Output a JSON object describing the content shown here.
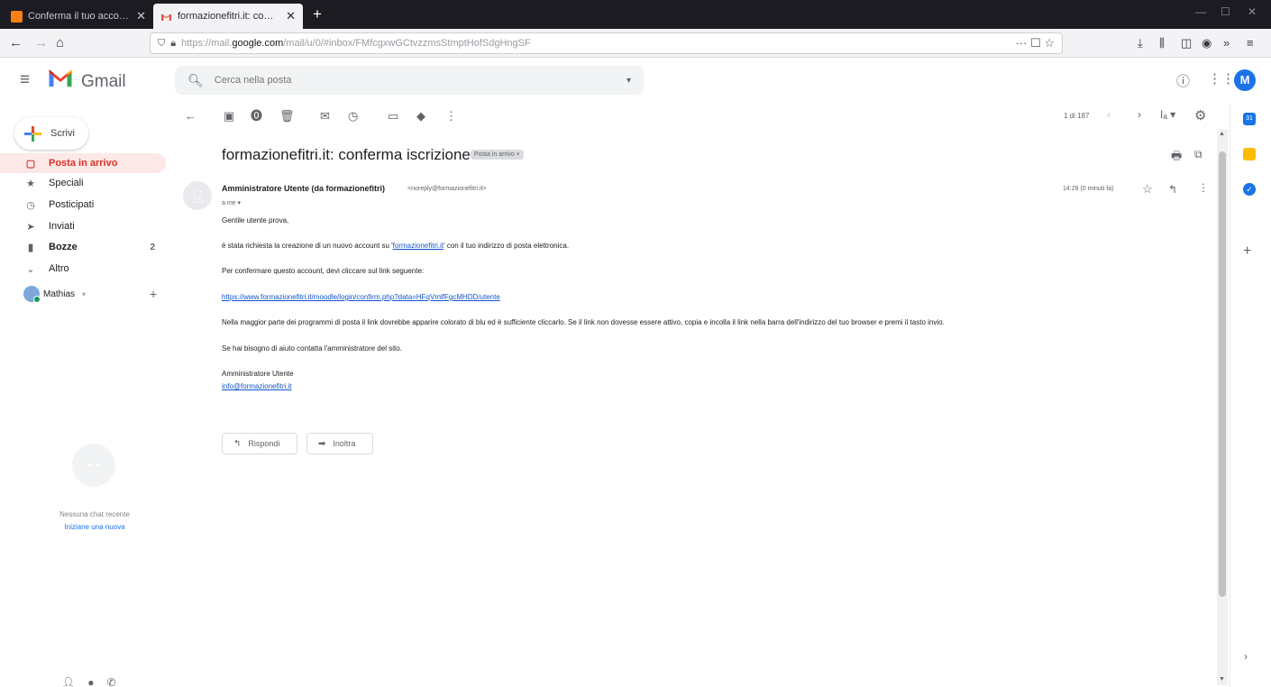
{
  "browser": {
    "tabs": [
      {
        "title": "Conferma il tuo account",
        "active": false
      },
      {
        "title": "formazionefitri.it: conferma iscr",
        "active": true
      }
    ],
    "url_prefix": "https://mail.",
    "url_domain": "google.com",
    "url_path": "/mail/u/0/#inbox/FMfcgxwGCtvzzmsStmptHofSdgHngSF",
    "url_actions": "··· ☐ ☆"
  },
  "gmail": {
    "logo_text": "Gmail",
    "search_placeholder": "Cerca nella posta",
    "avatar_letter": "M",
    "compose_label": "Scrivi",
    "nav": [
      {
        "label": "Posta in arrivo",
        "icon": "inbox-icon",
        "count": ""
      },
      {
        "label": "Speciali",
        "icon": "star-icon",
        "count": ""
      },
      {
        "label": "Posticipati",
        "icon": "clock-icon",
        "count": ""
      },
      {
        "label": "Inviati",
        "icon": "send-icon",
        "count": ""
      },
      {
        "label": "Bozze",
        "icon": "draft-icon",
        "count": "2"
      },
      {
        "label": "Altro",
        "icon": "chevron-down-icon",
        "count": ""
      }
    ],
    "hangouts_user": "Mathias",
    "no_chat": "Nessuna chat recente",
    "new_chat": "Iniziane una nuova"
  },
  "toolbar": {
    "page_count": "1 di 187"
  },
  "message": {
    "subject": "formazionefitri.it: conferma iscrizione",
    "label": "Posta in arrivo ×",
    "sender_name": "Amministratore Utente (da formazionefitri)",
    "sender_email": "<noreply@formazionefitri.it>",
    "to": "a me ▾",
    "time": "14:28 (0 minuti fa)",
    "greeting": "Gentile utente prova,",
    "line1_pre": "è stata richiesta la creazione di un nuovo account su '",
    "line1_link": "formazionefitri.it",
    "line1_post": "' con il tuo indirizzo di posta elettronica.",
    "line2": "Per confermare questo account, devi cliccare sul link seguente:",
    "confirm_link": "https://www.formazionefitri.it/moodle/login/confirm.php?data=HFqVmlfFgcMHDD/utente",
    "line3": "Nella maggior parte dei programmi di posta il link dovrebbe apparire colorato di blu ed è sufficiente cliccarlo. Se il link non dovesse essere attivo, copia e incolla il link nella barra dell'indirizzo del tuo browser e premi il tasto invio.",
    "line4": "Se hai bisogno di aiuto contatta l'amministratore del sito.",
    "signature_name": "Amministratore Utente",
    "signature_email": "info@formazionefitri.it",
    "reply_label": "Rispondi",
    "forward_label": "Inoltra"
  },
  "colors": {
    "accent_red": "#d93025",
    "link_blue": "#1155cc",
    "avatar_blue": "#1a73e8"
  }
}
